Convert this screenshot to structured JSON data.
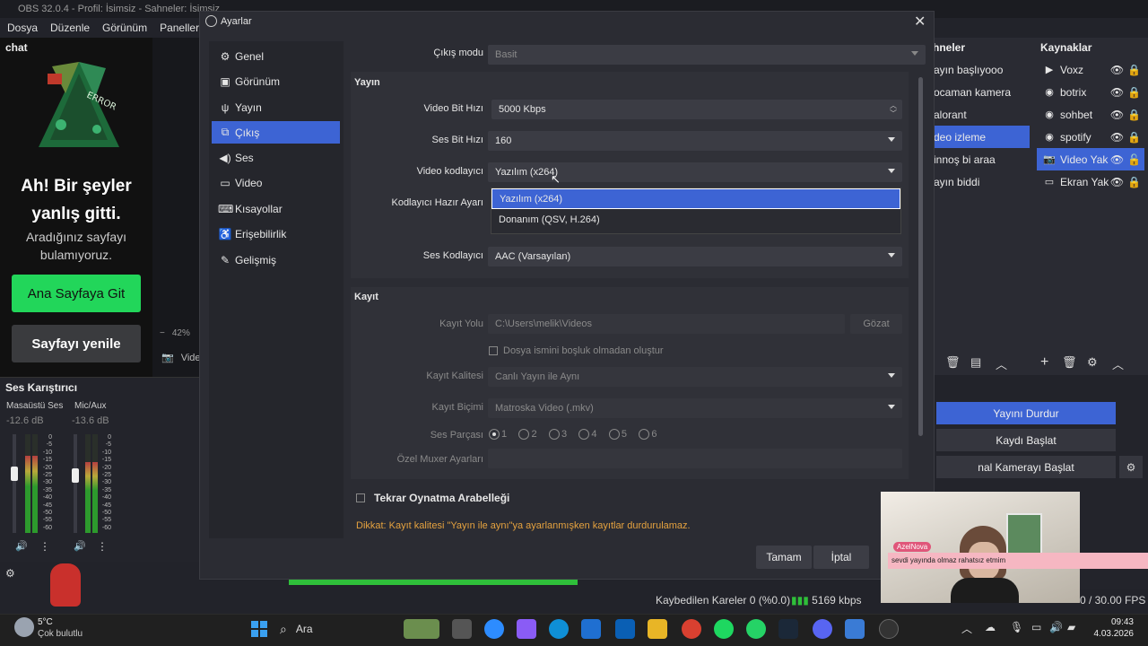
{
  "obs": {
    "title": "OBS 32.0.4 - Profil: İsimsiz - Sahneler: İsimsiz",
    "menu": [
      "Dosya",
      "Düzenle",
      "Görünüm",
      "Paneller"
    ],
    "chat_dock": {
      "title": "chat",
      "error_title": "Ah! Bir şeyler yanlış gitti.",
      "error_sub": "Aradığınız sayfayı bulamıyoruz.",
      "home_button": "Ana Sayfaya Git",
      "reload_button": "Sayfayı yenile",
      "graphic_text": "ERROR"
    },
    "zoom": "42%",
    "preview_label": "Vide",
    "mixer": {
      "title": "Ses Karıştırıcı",
      "channels": [
        {
          "name": "Masaüstü Ses",
          "db": "-12.6 dB",
          "level": 0.78
        },
        {
          "name": "Mic/Aux",
          "db": "-13.6 dB",
          "level": 0.72
        }
      ],
      "scale": [
        "0",
        "-5",
        "-10",
        "-15",
        "-20",
        "-25",
        "-30",
        "-35",
        "-40",
        "-45",
        "-50",
        "-55",
        "-60"
      ]
    },
    "scenes": {
      "title": "hneler",
      "items": [
        "ayın başlıyooo",
        "ocaman kamera",
        "alorant",
        "deo izleme",
        "innoş bi araa",
        "ayın biddi"
      ],
      "selected_index": 3
    },
    "sources": {
      "title": "Kaynaklar",
      "items": [
        {
          "label": "Voxz",
          "icon": "play-icon"
        },
        {
          "label": "botrix",
          "icon": "globe-icon"
        },
        {
          "label": "sohbet",
          "icon": "globe-icon"
        },
        {
          "label": "spotify",
          "icon": "globe-icon"
        },
        {
          "label": "Video Yak",
          "icon": "camera-icon"
        },
        {
          "label": "Ekran Yak",
          "icon": "monitor-icon"
        }
      ],
      "selected_index": 4
    },
    "controls": {
      "stop_stream": "Yayını Durdur",
      "start_record": "Kaydı Başlat",
      "start_vcam": "nal Kamerayı Başlat"
    },
    "status": {
      "dropped_frames": "Kaybedilen Kareler 0 (%0.0)",
      "bitrate": "5169 kbps",
      "fps": "0 / 30.00 FPS"
    }
  },
  "dialog": {
    "title": "Ayarlar",
    "sidebar": [
      {
        "label": "Genel",
        "icon": "gear-icon"
      },
      {
        "label": "Görünüm",
        "icon": "palette-icon"
      },
      {
        "label": "Yayın",
        "icon": "antenna-icon"
      },
      {
        "label": "Çıkış",
        "icon": "output-icon"
      },
      {
        "label": "Ses",
        "icon": "speaker-icon"
      },
      {
        "label": "Video",
        "icon": "monitor-icon"
      },
      {
        "label": "Kısayollar",
        "icon": "keyboard-icon"
      },
      {
        "label": "Erişebilirlik",
        "icon": "accessibility-icon"
      },
      {
        "label": "Gelişmiş",
        "icon": "wrench-icon"
      }
    ],
    "selected_index": 3,
    "output_mode": {
      "label": "Çıkış modu",
      "value": "Basit"
    },
    "stream": {
      "title": "Yayın",
      "video_bitrate": {
        "label": "Video Bit Hızı",
        "value": "5000 Kbps"
      },
      "audio_bitrate": {
        "label": "Ses Bit Hızı",
        "value": "160"
      },
      "video_encoder": {
        "label": "Video kodlayıcı",
        "value": "Yazılım (x264)"
      },
      "encoder_preset": {
        "label": "Kodlayıcı Hazır Ayarı"
      },
      "audio_encoder": {
        "label": "Ses Kodlayıcı",
        "value": "AAC (Varsayılan)"
      },
      "encoder_options": [
        "Yazılım (x264)",
        "Donanım (QSV, H.264)"
      ]
    },
    "record": {
      "title": "Kayıt",
      "path": {
        "label": "Kayıt Yolu",
        "value": "C:\\Users\\melik\\Videos",
        "browse": "Gözat"
      },
      "no_space": "Dosya ismini boşluk olmadan oluştur",
      "quality": {
        "label": "Kayıt Kalitesi",
        "value": "Canlı Yayın ile Aynı"
      },
      "format": {
        "label": "Kayıt Biçimi",
        "value": "Matroska Video (.mkv)"
      },
      "tracks": {
        "label": "Ses Parçası",
        "options": [
          "1",
          "2",
          "3",
          "4",
          "5",
          "6"
        ],
        "selected": "1"
      },
      "muxer": {
        "label": "Özel Muxer Ayarları",
        "value": ""
      }
    },
    "replay_buffer": "Tekrar Oynatma Arabelleği",
    "warning": "Dikkat: Kayıt kalitesi \"Yayın ile aynı\"ya ayarlanmışken kayıtlar durdurulamaz.",
    "ok_button": "Tamam",
    "cancel_button": "İptal"
  },
  "webcam": {
    "name_tag": "AzelNova",
    "banner": "sevdi yayında olmaz rahatsız etmim"
  },
  "taskbar": {
    "weather_temp": "5°C",
    "weather_desc": "Çok bulutlu",
    "search": "Ara",
    "time": "09:43",
    "date": "4.03.2026"
  },
  "colors": {
    "accent": "#3d64d4",
    "green": "#22d65a",
    "warning": "#e5a23f"
  }
}
